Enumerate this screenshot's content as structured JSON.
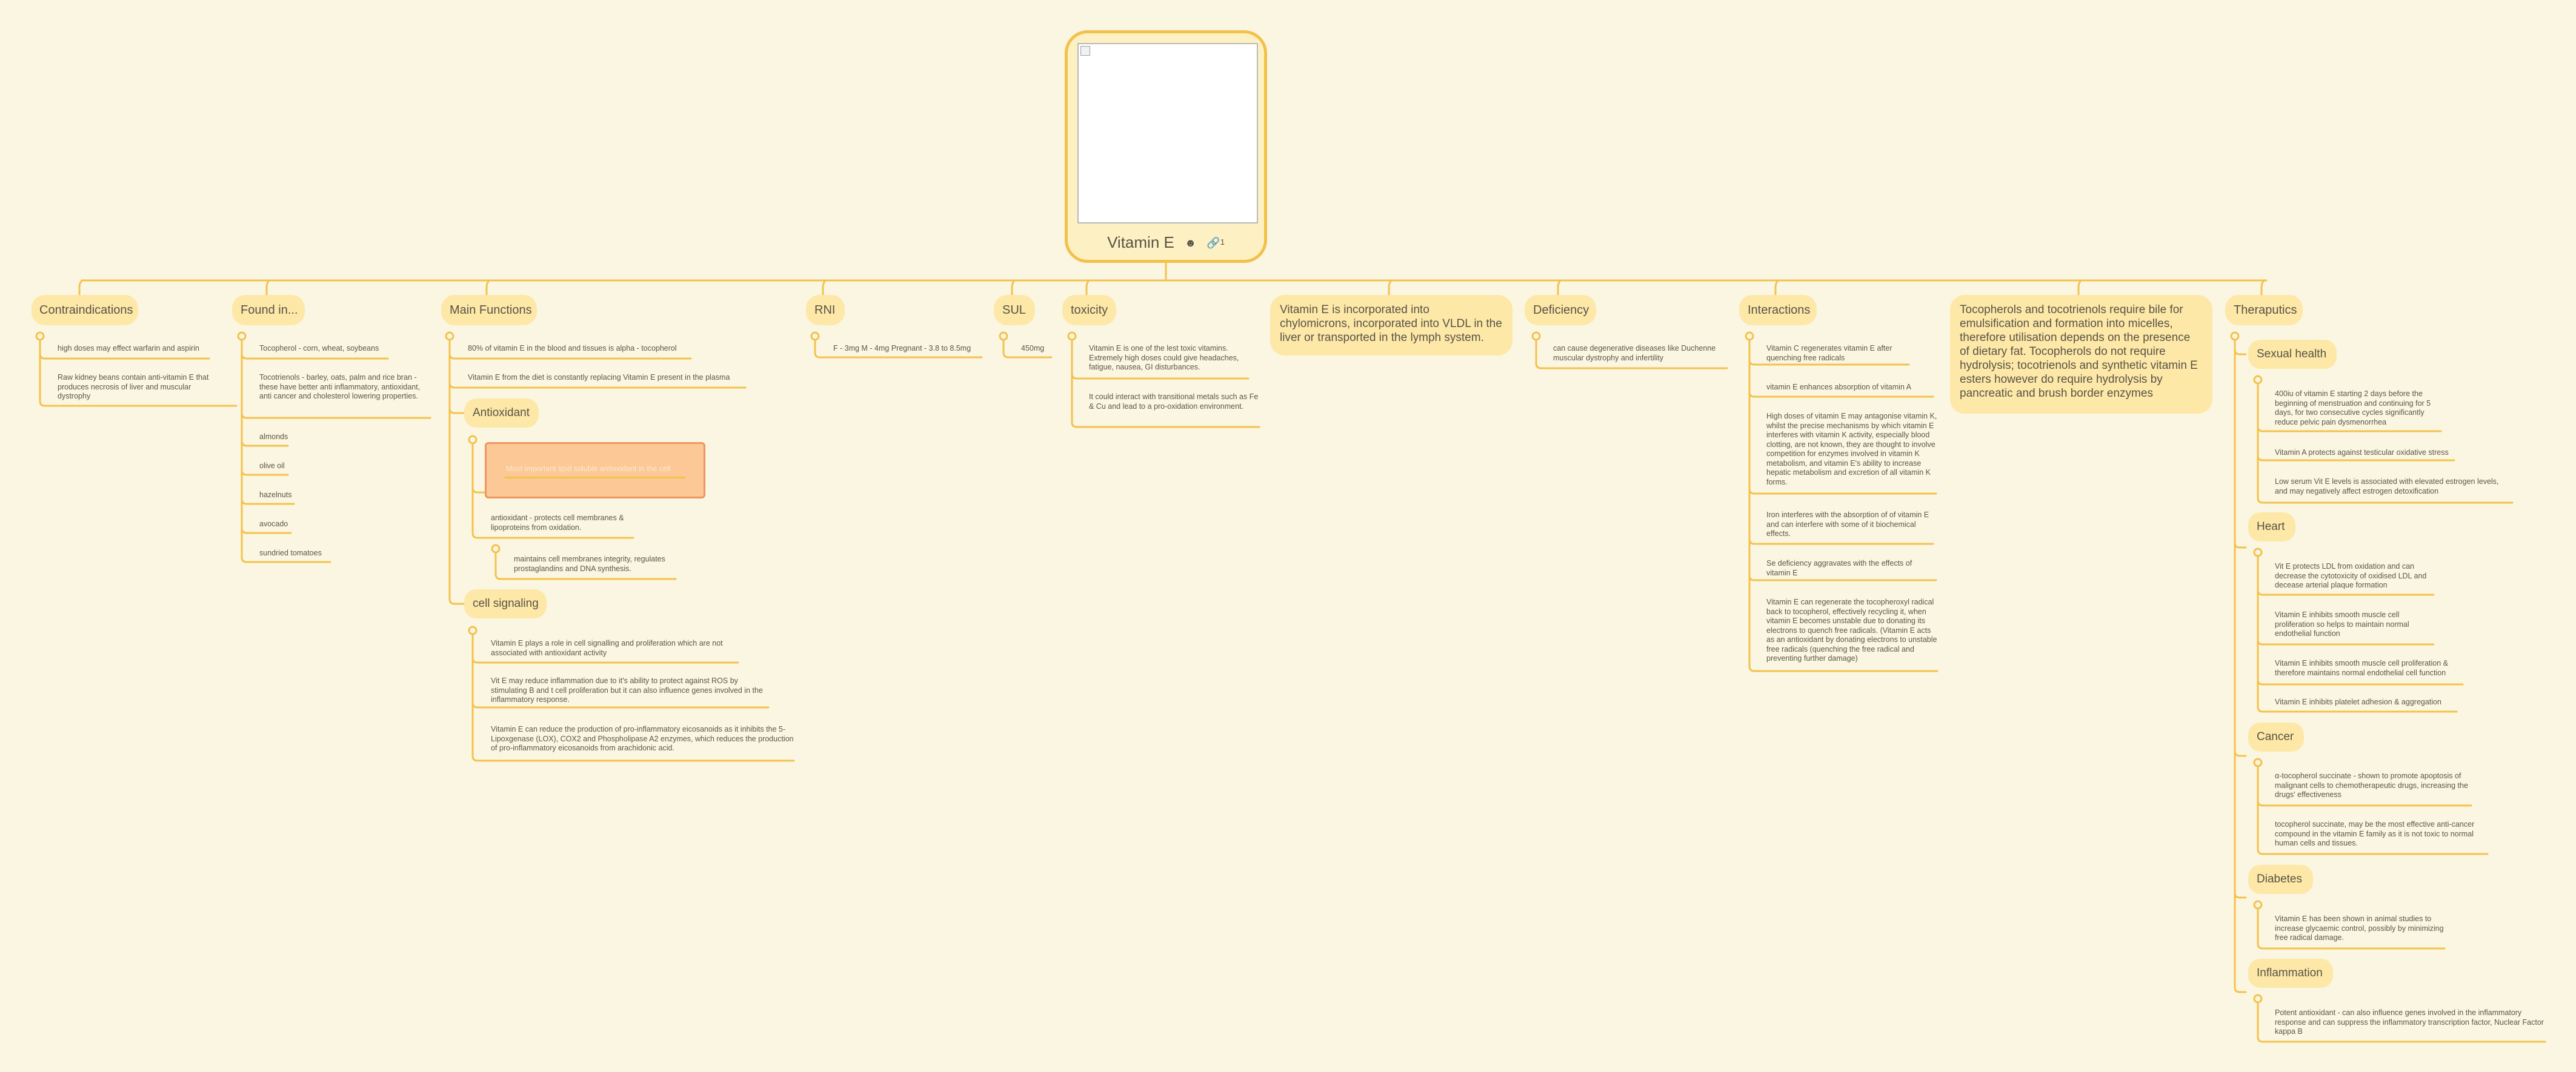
{
  "root": {
    "title": "Vitamin E",
    "icon": "mask-icon",
    "link_icon": "link-icon",
    "link_count": "1"
  },
  "topics": {
    "contraindications": {
      "label": "Contraindications",
      "items": [
        "high doses may effect warfarin and aspirin",
        "Raw kidney beans contain anti-vitamin E that produces necrosis of liver and muscular dystrophy"
      ]
    },
    "found_in": {
      "label": "Found in...",
      "items": [
        "Tocopherol - corn, wheat, soybeans",
        "Tocotrienols - barley, oats, palm and rice bran - these have better anti inflammatory, antioxidant, anti cancer and cholesterol lowering properties.",
        "almonds",
        "olive oil",
        "hazelnuts",
        "avocado",
        "sundried tomatoes"
      ]
    },
    "main_functions": {
      "label": "Main Functions",
      "items": [
        "80% of vitamin E in the blood and tissues is  alpha - tocopherol",
        "Vitamin E from the diet is constantly replacing Vitamin E present in the plasma"
      ],
      "antioxidant": {
        "label": "Antioxidant",
        "highlight": "Most important lipid soluble antioxidant in the cell",
        "items": [
          "antioxidant - protects cell membranes & lipoproteins from oxidation.",
          "maintains cell membranes integrity, regulates prostaglandins and DNA synthesis."
        ]
      },
      "cell_signaling": {
        "label": "cell signaling",
        "items": [
          "Vitamin E plays a role in cell signalling and proliferation which are not associated with antioxidant activity",
          "Vit E may reduce inflammation due to it's ability to protect against ROS by stimulating B and t cell proliferation but it can also influence genes involved in the inflammatory response.",
          "Vitamin E can reduce the production of pro-inflammatory eicosanoids as it inhibits the 5-Lipoxgenase (LOX), COX2 and Phospholipase A2 enzymes, which reduces the production of pro-inflammatory eicosanoids from arachidonic acid."
        ]
      }
    },
    "rni": {
      "label": "RNI",
      "items": [
        "F - 3mg M - 4mg Pregnant - 3.8 to 8.5mg"
      ]
    },
    "sul": {
      "label": "SUL",
      "items": [
        "450mg"
      ]
    },
    "toxicity": {
      "label": "toxicity",
      "items": [
        "Vitamin E is one of the lest toxic vitamins. Extremely high doses could give headaches, fatigue, nausea, GI disturbances.",
        "It could interact with transitional metals such as Fe & Cu and lead to a pro-oxidation environment."
      ]
    },
    "chylomicrons": {
      "label": "Vitamin E is incorporated into chylomicrons, incorporated into VLDL in the liver or transported in the lymph system."
    },
    "deficiency": {
      "label": "Deficiency",
      "items": [
        "can cause degenerative diseases like Duchenne muscular dystrophy and infertility"
      ]
    },
    "interactions": {
      "label": "Interactions",
      "items": [
        "Vitamin C regenerates vitamin E after quenching free radicals",
        "vitamin E enhances absorption of vitamin A",
        "High doses of vitamin E may antagonise vitamin K,  whilst the precise mechanisms by which vitamin E interferes with vitamin K activity, especially blood clotting, are not known, they are thought to involve competition for enzymes involved in vitamin K metabolism, and vitamin E's ability to increase hepatic metabolism and excretion of all vitamin K forms.",
        "Iron interferes with the absorption of of vitamin E and can interfere with some of it biochemical effects.",
        "Se deficiency aggravates with the effects of vitamin E",
        "Vitamin E can regenerate the tocopheroxyl radical back to tocopherol, effectively recycling it, when vitamin E becomes unstable due to donating its electrons to quench free radicals. (Vitamin E acts as an antioxidant by donating electrons to unstable free radicals (quenching the free radical and preventing further damage)"
      ]
    },
    "bile": {
      "label": "Tocopherols and tocotrienols require bile for emulsification and formation into micelles, therefore utilisation depends on the presence of dietary fat.  Tocopherols do not require hydrolysis; tocotrienols and synthetic vitamin E esters however do require hydrolysis by pancreatic and brush border enzymes"
    },
    "therapeutics": {
      "label": "Theraputics",
      "sexual_health": {
        "label": "Sexual health",
        "items": [
          "400iu of vitamin E starting 2 days before the beginning of menstruation and continuing for 5 days, for two consecutive cycles significantly reduce pelvic pain dysmenorrhea",
          "Vitamin A protects against testicular oxidative stress",
          "Low serum Vit E levels is associated with elevated estrogen levels, and may negatively affect estrogen detoxification"
        ]
      },
      "heart": {
        "label": "Heart",
        "items": [
          "Vit E protects LDL from oxidation and can decrease the cytotoxicity of oxidised LDL and decease arterial plaque formation",
          "Vitamin E inhibits smooth muscle cell proliferation so helps to maintain normal endothelial function",
          "Vitamin E inhibits smooth muscle cell proliferation & therefore maintains normal endothelial cell function",
          "Vitamin E inhibits platelet adhesion & aggregation"
        ]
      },
      "cancer": {
        "label": "Cancer",
        "items": [
          "α-tocopherol succinate - shown to promote apoptosis of malignant cells to chemotherapeutic drugs, increasing the drugs' effectiveness",
          "tocopherol succinate, may be the most effective anti-cancer compound in the vitamin E family as it is not toxic to normal human cells and tissues."
        ]
      },
      "diabetes": {
        "label": "Diabetes",
        "items": [
          "Vitamin E has been shown in animal studies to increase glycaemic control, possibly by minimizing free radical damage."
        ]
      },
      "inflammation": {
        "label": "Inflammation",
        "items": [
          "Potent antioxidant - can also influence genes involved in the inflammatory response and can suppress the inflammatory transcription factor, Nuclear Factor kappa B"
        ]
      }
    }
  },
  "colors": {
    "background": "#fbf6e1",
    "topic_fill": "#fde8a8",
    "branch": "#f3c24d",
    "highlight_fill": "#fbc896",
    "highlight_border": "#ee9562"
  }
}
